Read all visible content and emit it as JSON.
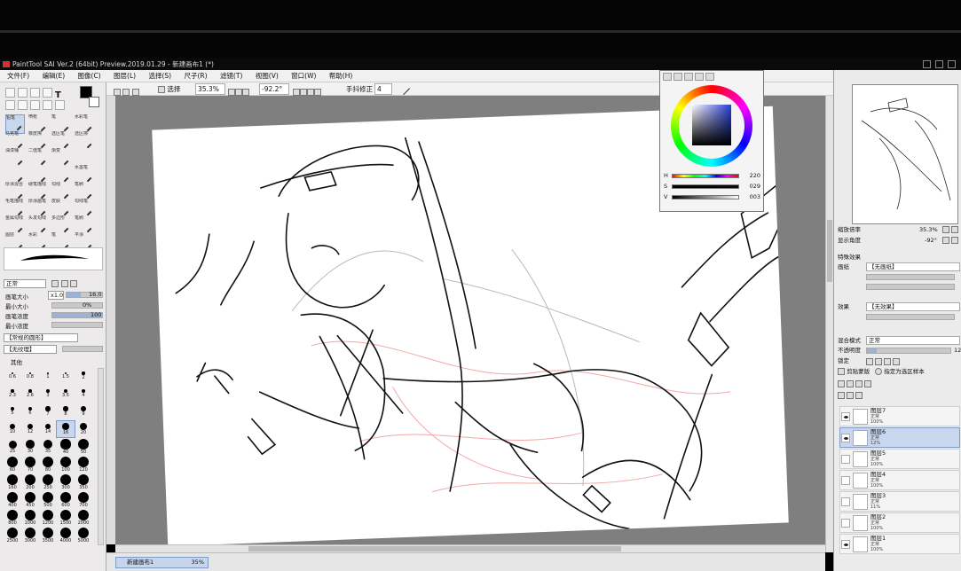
{
  "window": {
    "title": "PaintTool SAI Ver.2 (64bit) Preview.2019.01.29 - 新建画布1 (*)"
  },
  "menu": [
    "文件(F)",
    "编辑(E)",
    "图像(C)",
    "图层(L)",
    "选择(S)",
    "尺子(R)",
    "滤镜(T)",
    "视图(V)",
    "窗口(W)",
    "帮助(H)"
  ],
  "toolbar": {
    "selection_label": "选择",
    "zoom": "35.3%",
    "angle": "-92.2°",
    "stabilizer_label": "手抖修正",
    "stabilizer_value": "4"
  },
  "brush_tools": [
    [
      "铅笔",
      "喷枪",
      "笔",
      "水彩笔"
    ],
    [
      "马克笔",
      "橡皮擦",
      "选区笔",
      "选区擦"
    ],
    [
      "油漆桶",
      "二值笔",
      "渐变"
    ],
    [
      "",
      "",
      "",
      "水墨笔"
    ],
    [
      "厚涂混合",
      "硬笔描线",
      "勾线",
      "笔刷"
    ],
    [
      "毛笔描线",
      "厚涂画笔",
      "皮肤",
      "勾线笔"
    ],
    [
      "金属勾线",
      "头发勾线",
      "多边形",
      "笔刷"
    ],
    [
      "图层",
      "水彩",
      "笔",
      "平涂"
    ]
  ],
  "brush_settings": {
    "blend_mode": "正常",
    "size_label": "画笔大小",
    "size_multiplier": "x1.0",
    "size_value": "16.0",
    "min_size_label": "最小大小",
    "min_size_value": "0%",
    "density_label": "画笔浓度",
    "density_value": "100",
    "min_density_label": "最小浓度",
    "shape_label": "【常规的圆形】",
    "texture_label": "【无纹理】",
    "advanced_label": "其他"
  },
  "brush_sizes": [
    "0.6",
    "0.8",
    "1",
    "1.5",
    "2",
    "2.3",
    "2.6",
    "3",
    "3.5",
    "4",
    "5",
    "6",
    "7",
    "8",
    "9",
    "10",
    "12",
    "14",
    "16",
    "20",
    "25",
    "30",
    "35",
    "40",
    "50",
    "60",
    "70",
    "80",
    "100",
    "120",
    "160",
    "200",
    "250",
    "300",
    "350",
    "400",
    "450",
    "500",
    "600",
    "700",
    "800",
    "1000",
    "1200",
    "1500",
    "2000",
    "2500",
    "3000",
    "3500",
    "4000",
    "5000"
  ],
  "color_panel": {
    "h": "220",
    "s": "029",
    "v": "003",
    "h_label": "H",
    "s_label": "S",
    "v_label": "V"
  },
  "navigator": {
    "zoom_label": "缩放倍率",
    "zoom_value": "35.3%",
    "angle_label": "显示角度",
    "angle_value": "-92°"
  },
  "layer_panel": {
    "effects_label": "特殊效果",
    "paper_label": "画纸",
    "paper_value": "【无画纸】",
    "effect_label": "效果",
    "effect_value": "【无效果】",
    "blend_label": "混合模式",
    "blend_value": "正常",
    "opacity_label": "不透明度",
    "opacity_value": "12",
    "lock_label": "锁定",
    "clip_label": "剪贴蒙版",
    "ref_label": "指定为选区样本",
    "layers": [
      {
        "name": "图层7",
        "mode": "正常",
        "opacity": "100%",
        "visible": true,
        "selected": false
      },
      {
        "name": "图层6",
        "mode": "正常",
        "opacity": "12%",
        "visible": true,
        "selected": true
      },
      {
        "name": "图层5",
        "mode": "正常",
        "opacity": "100%",
        "visible": false,
        "selected": false
      },
      {
        "name": "图层4",
        "mode": "正常",
        "opacity": "100%",
        "visible": false,
        "selected": false
      },
      {
        "name": "图层3",
        "mode": "正常",
        "opacity": "11%",
        "visible": false,
        "selected": false
      },
      {
        "name": "图层2",
        "mode": "正常",
        "opacity": "100%",
        "visible": false,
        "selected": false
      },
      {
        "name": "图层1",
        "mode": "正常",
        "opacity": "100%",
        "visible": true,
        "selected": false
      }
    ]
  },
  "canvas_tab": {
    "name": "新建画布1",
    "zoom": "35%"
  }
}
